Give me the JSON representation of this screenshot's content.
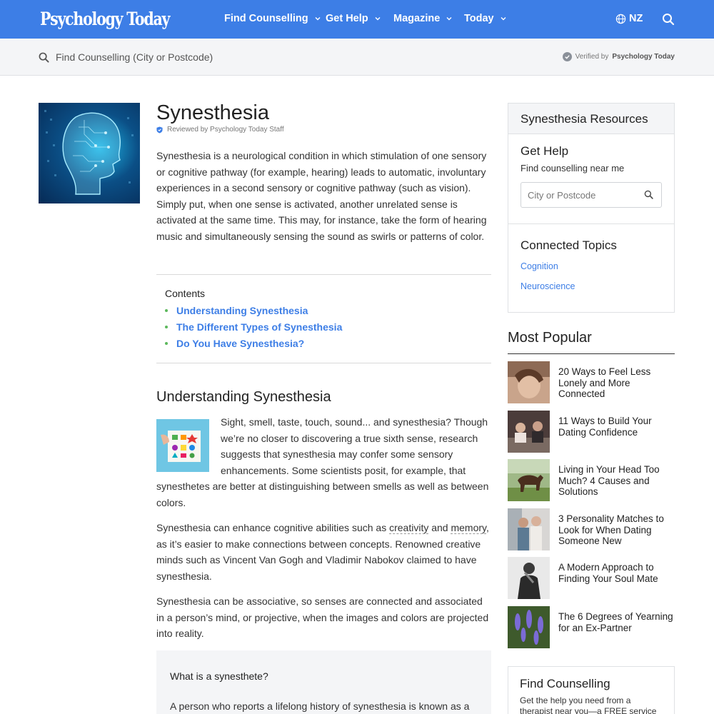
{
  "header": {
    "logo": "Psychology Today",
    "nav": [
      {
        "label": "Find Counselling"
      },
      {
        "label": "Get Help"
      },
      {
        "label": "Magazine"
      },
      {
        "label": "Today"
      }
    ],
    "region": "NZ"
  },
  "search_strip": {
    "placeholder": "Find Counselling (City or Postcode)",
    "verified_prefix": "Verified by",
    "verified_brand": "Psychology Today"
  },
  "article": {
    "title": "Synesthesia",
    "reviewed": "Reviewed by Psychology Today Staff",
    "intro": "Synesthesia is a neurological condition in which stimulation of one sensory or cognitive pathway (for example, hearing) leads to automatic, involuntary experiences in a second sensory or cognitive pathway (such as vision). Simply put, when one sense is activated, another unrelated sense is activated at the same time. This may, for instance, take the form of hearing music and simultaneously sensing the sound as swirls or patterns of color.",
    "contents_title": "Contents",
    "contents": [
      "Understanding Synesthesia",
      "The Different Types of Synesthesia",
      "Do You Have Synesthesia?"
    ],
    "section_title": "Understanding Synesthesia",
    "para1": "Sight, smell, taste, touch, sound... and synesthesia? Though we’re no closer to discovering a true sixth sense, research suggests that synesthesia may confer some sensory enhancements. Some scientists posit, for example, that synesthetes are better at distinguishing between smells as well as between colors.",
    "para2_a": "Synesthesia can enhance cognitive abilities such as ",
    "para2_link1": "creativity",
    "para2_b": " and ",
    "para2_link2": "memory",
    "para2_c": ", as it’s easier to make connections between concepts. Renowned creative minds such as Vincent Van Gogh and Vladimir Nabokov claimed to have synesthesia.",
    "para3": "Synesthesia can be associative, so senses are connected and associated in a person’s mind, or projective, when the images and colors are projected into reality.",
    "callout_title": "What is a synesthete?",
    "callout_text": "A person who reports a lifelong history of synesthesia is known as a"
  },
  "sidebar": {
    "resources_title": "Synesthesia Resources",
    "gethelp_title": "Get Help",
    "gethelp_sub": "Find counselling near me",
    "search_placeholder": "City or Postcode",
    "topics_title": "Connected Topics",
    "topics": [
      "Cognition",
      "Neuroscience"
    ],
    "popular_title": "Most Popular",
    "popular": [
      "20 Ways to Feel Less Lonely and More Connected",
      "11 Ways to Build Your Dating Confidence",
      "Living in Your Head Too Much? 4 Causes and Solutions",
      "3 Personality Matches to Look for When Dating Someone New",
      "A Modern Approach to Finding Your Soul Mate",
      "The 6 Degrees of Yearning for an Ex-Partner"
    ],
    "findc_title": "Find Counselling",
    "findc_text": "Get the help you need from a therapist near you—a FREE service"
  },
  "colors": {
    "brand": "#3d7ee6",
    "bullet": "#5cb85c",
    "strip": "#f4f5f7"
  },
  "icons": [
    "chevron-down-icon",
    "globe-icon",
    "search-icon",
    "check-icon",
    "shield-icon"
  ]
}
